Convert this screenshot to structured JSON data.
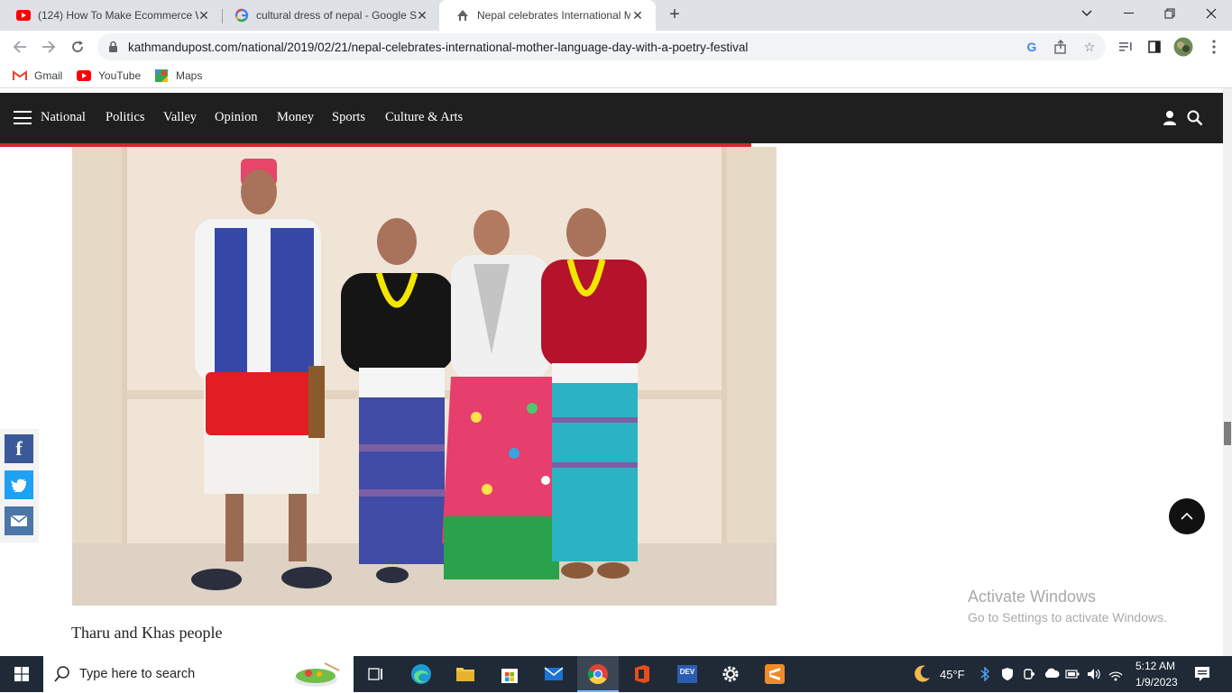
{
  "tabs": [
    {
      "title": "(124) How To Make Ecommerce W",
      "icon": "youtube-icon",
      "active": false
    },
    {
      "title": "cultural dress of nepal - Google S",
      "icon": "google-icon",
      "active": false
    },
    {
      "title": "Nepal celebrates International M",
      "icon": "kathmandu-post-icon",
      "active": true
    }
  ],
  "address_bar": {
    "url": "kathmandupost.com/national/2019/02/21/nepal-celebrates-international-mother-language-day-with-a-poetry-festival"
  },
  "bookmarks": [
    {
      "label": "Gmail",
      "icon": "gmail-icon"
    },
    {
      "label": "YouTube",
      "icon": "youtube-icon"
    },
    {
      "label": "Maps",
      "icon": "maps-icon"
    }
  ],
  "site_nav": {
    "items": [
      "National",
      "Politics",
      "Valley",
      "Opinion",
      "Money",
      "Sports",
      "Culture & Arts"
    ]
  },
  "article": {
    "caption": "Tharu and Khas people"
  },
  "share": [
    {
      "label": "f",
      "network": "facebook",
      "color": "#3b5998"
    },
    {
      "label": "t",
      "network": "twitter",
      "color": "#1da1f2"
    },
    {
      "label": "mail",
      "network": "email",
      "color": "#4a76a8"
    }
  ],
  "watermark": {
    "line1": "Activate Windows",
    "line2": "Go to Settings to activate Windows."
  },
  "taskbar": {
    "search_placeholder": "Type here to search",
    "temperature": "45°F",
    "time": "5:12 AM",
    "date": "1/9/2023"
  },
  "colors": {
    "site_nav_bg": "#1f1f1f",
    "accent_red": "#d0282e",
    "taskbar_bg": "#1f2a36"
  }
}
